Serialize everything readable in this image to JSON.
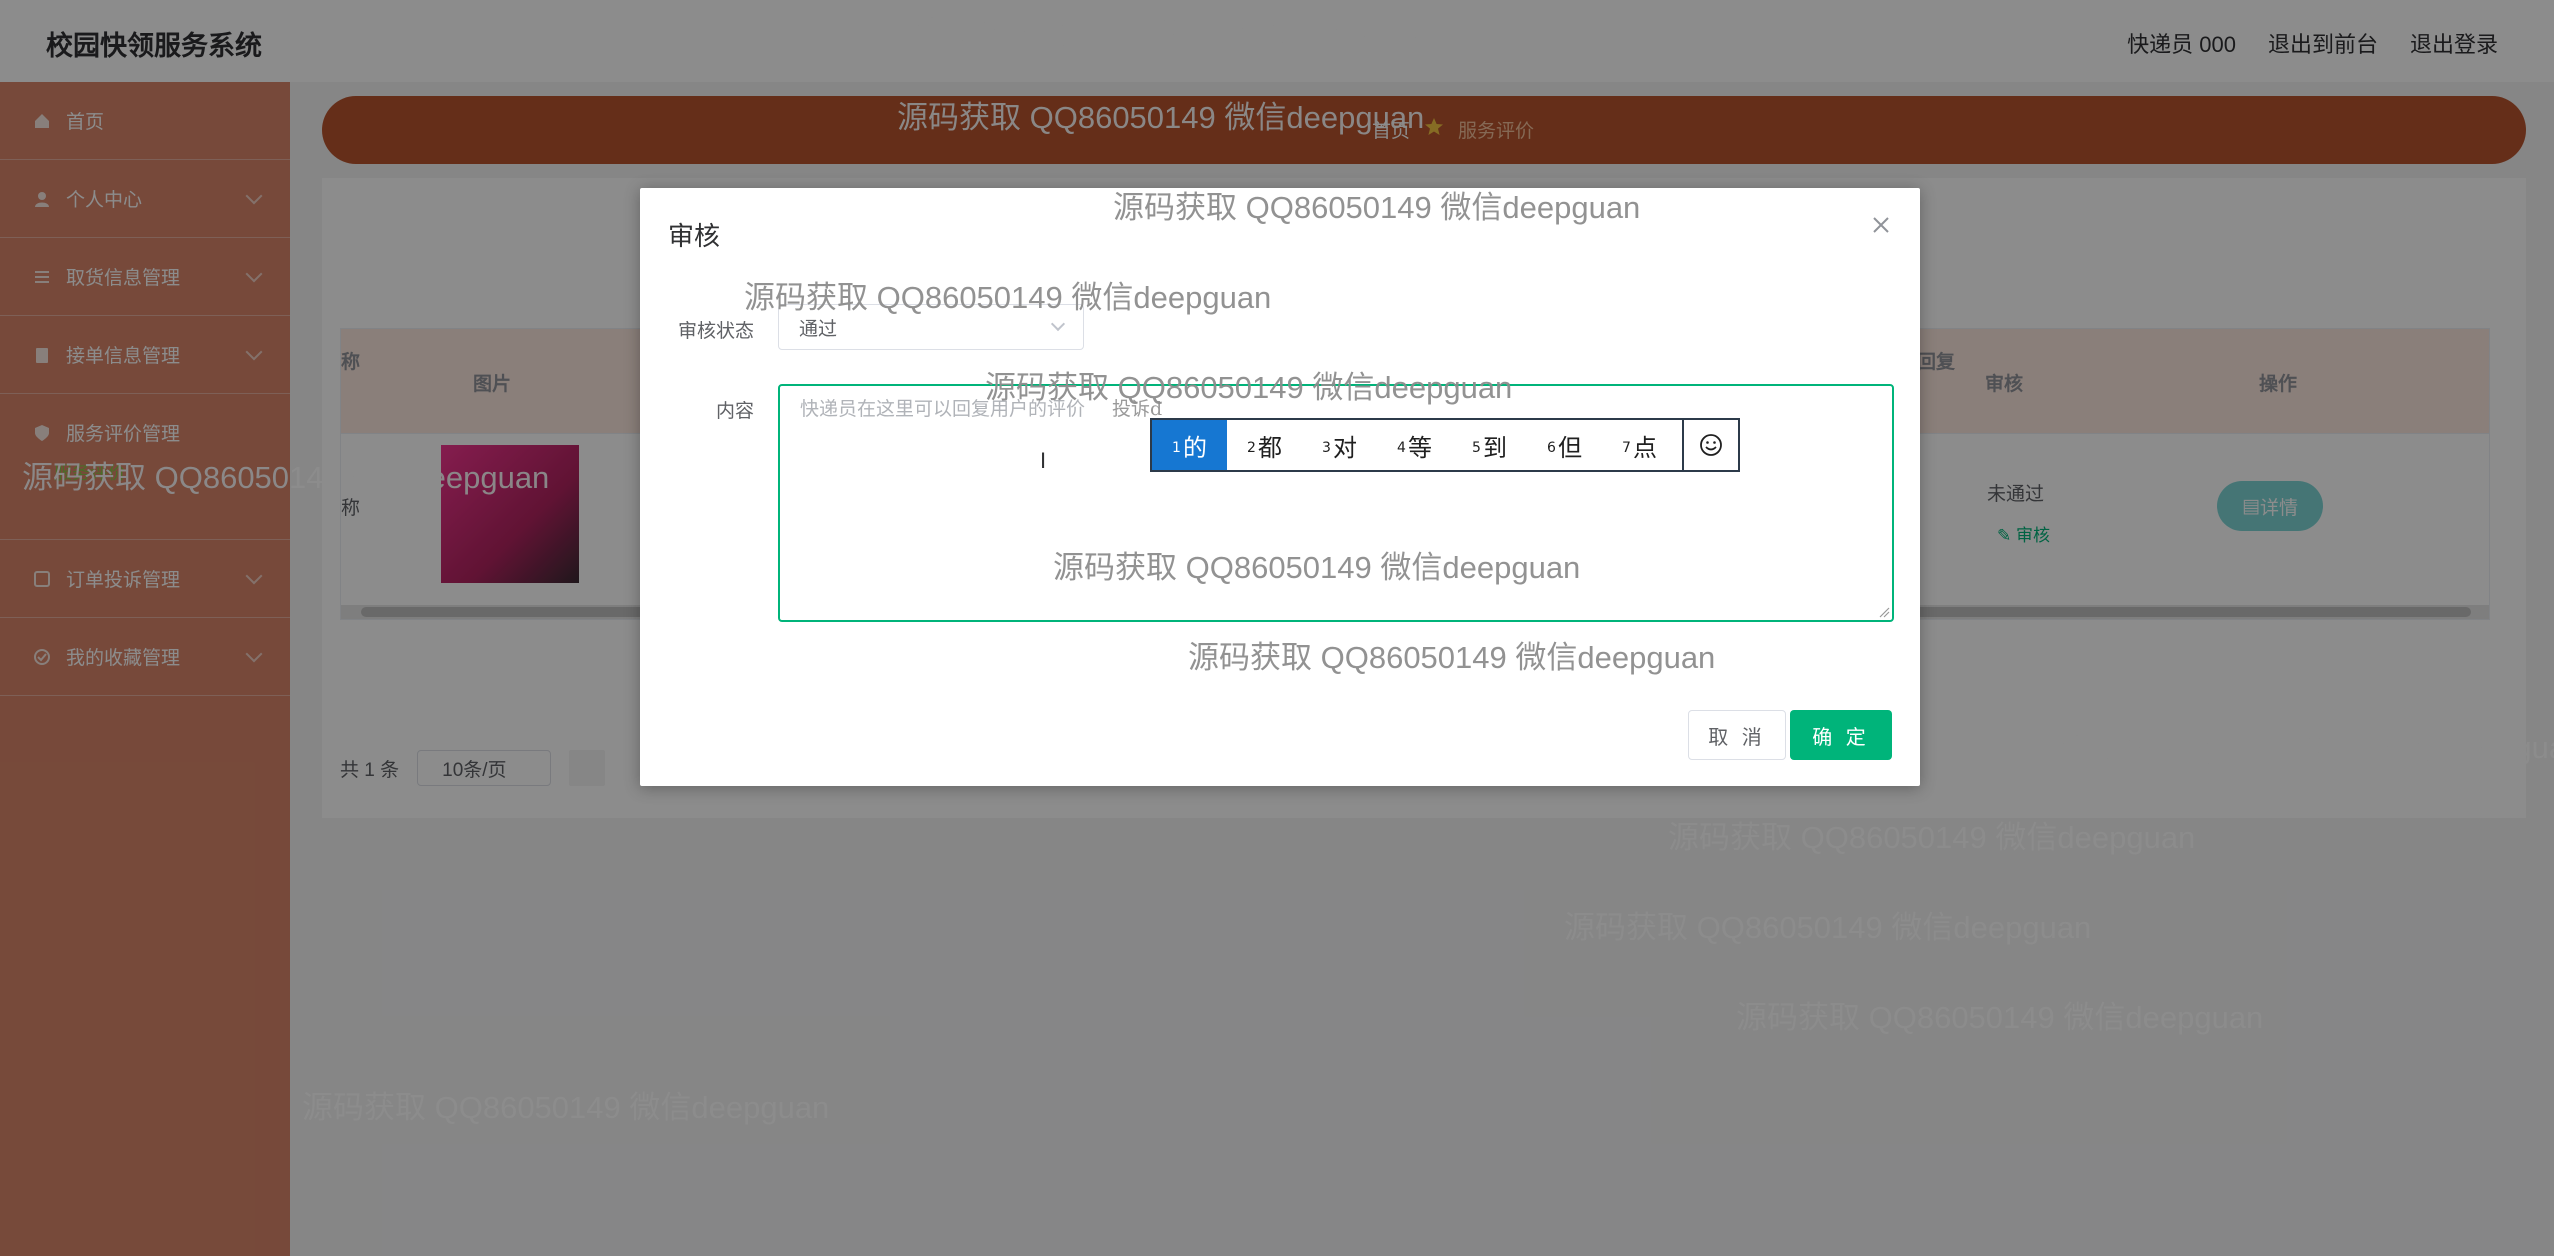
{
  "app": {
    "brand": "校园快领服务系统",
    "top_links": [
      "快递员 000",
      "退出到前台",
      "退出登录"
    ]
  },
  "sidebar": {
    "items": [
      {
        "label": "首页",
        "icon": "home-icon"
      },
      {
        "label": "个人中心",
        "icon": "user-icon"
      },
      {
        "label": "取货信息管理",
        "icon": "list-icon"
      },
      {
        "label": "接单信息管理",
        "icon": "clipboard-icon"
      },
      {
        "label": "服务评价管理",
        "icon": "shield-icon",
        "sub": "服务评价"
      },
      {
        "label": "订单投诉管理",
        "icon": "box-icon"
      },
      {
        "label": "我的收藏管理",
        "icon": "check-icon"
      }
    ]
  },
  "breadcrumb": {
    "home": "首页",
    "current": "服务评价"
  },
  "table": {
    "headers": {
      "name_partial": "称",
      "image": "图片",
      "reply": "回复",
      "audit": "审核",
      "action": "操作"
    },
    "row": {
      "name_partial": "称",
      "audit_status": "未通过",
      "audit_link": "审核",
      "detail_button": "详情"
    }
  },
  "pager": {
    "total": "共 1 条",
    "page_size": "10条/页"
  },
  "dialog": {
    "title": "审核",
    "status_label": "审核状态",
    "status_value": "通过",
    "content_label": "内容",
    "content_placeholder": "快递员在这里可以回复用户的评价",
    "content_value": "投诉d",
    "cancel": "取 消",
    "confirm": "确 定"
  },
  "ime": {
    "candidates": [
      {
        "n": "1",
        "c": "的"
      },
      {
        "n": "2",
        "c": "都"
      },
      {
        "n": "3",
        "c": "对"
      },
      {
        "n": "4",
        "c": "等"
      },
      {
        "n": "5",
        "c": "到"
      },
      {
        "n": "6",
        "c": "但"
      },
      {
        "n": "7",
        "c": "点"
      }
    ]
  },
  "watermark": "源码获取 QQ86050149 微信deepguan"
}
